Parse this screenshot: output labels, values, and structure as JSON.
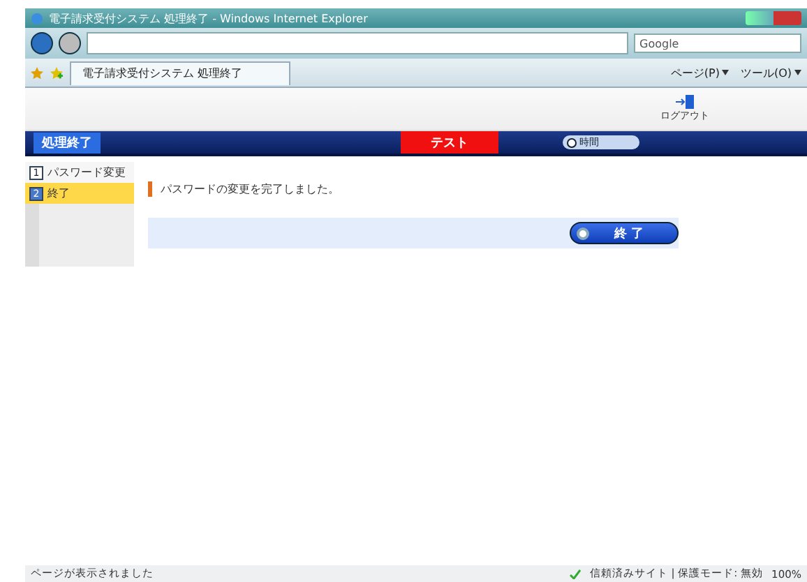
{
  "window": {
    "title": "電子請求受付システム 処理終了 - Windows Internet Explorer"
  },
  "search": {
    "placeholder": "Google"
  },
  "tabs": [
    {
      "label": "電子請求受付システム 処理終了",
      "selected": true
    }
  ],
  "command_bar": [
    {
      "label": "ページ(P)"
    },
    {
      "label": "ツール(O)"
    }
  ],
  "app": {
    "logout": "ログアウト",
    "page_title": "処理終了",
    "environment": "テスト",
    "time_label": "時間",
    "steps": [
      {
        "number": "1",
        "label": "パスワード変更",
        "selected": false
      },
      {
        "number": "2",
        "label": "終了",
        "selected": true
      }
    ],
    "message": "パスワードの変更を完了しました。",
    "finish_button": "終 了"
  },
  "status_bar": {
    "text": "ページが表示されました",
    "zone": "信頼済みサイト | 保護モード: 無効",
    "zoom": "100%"
  }
}
